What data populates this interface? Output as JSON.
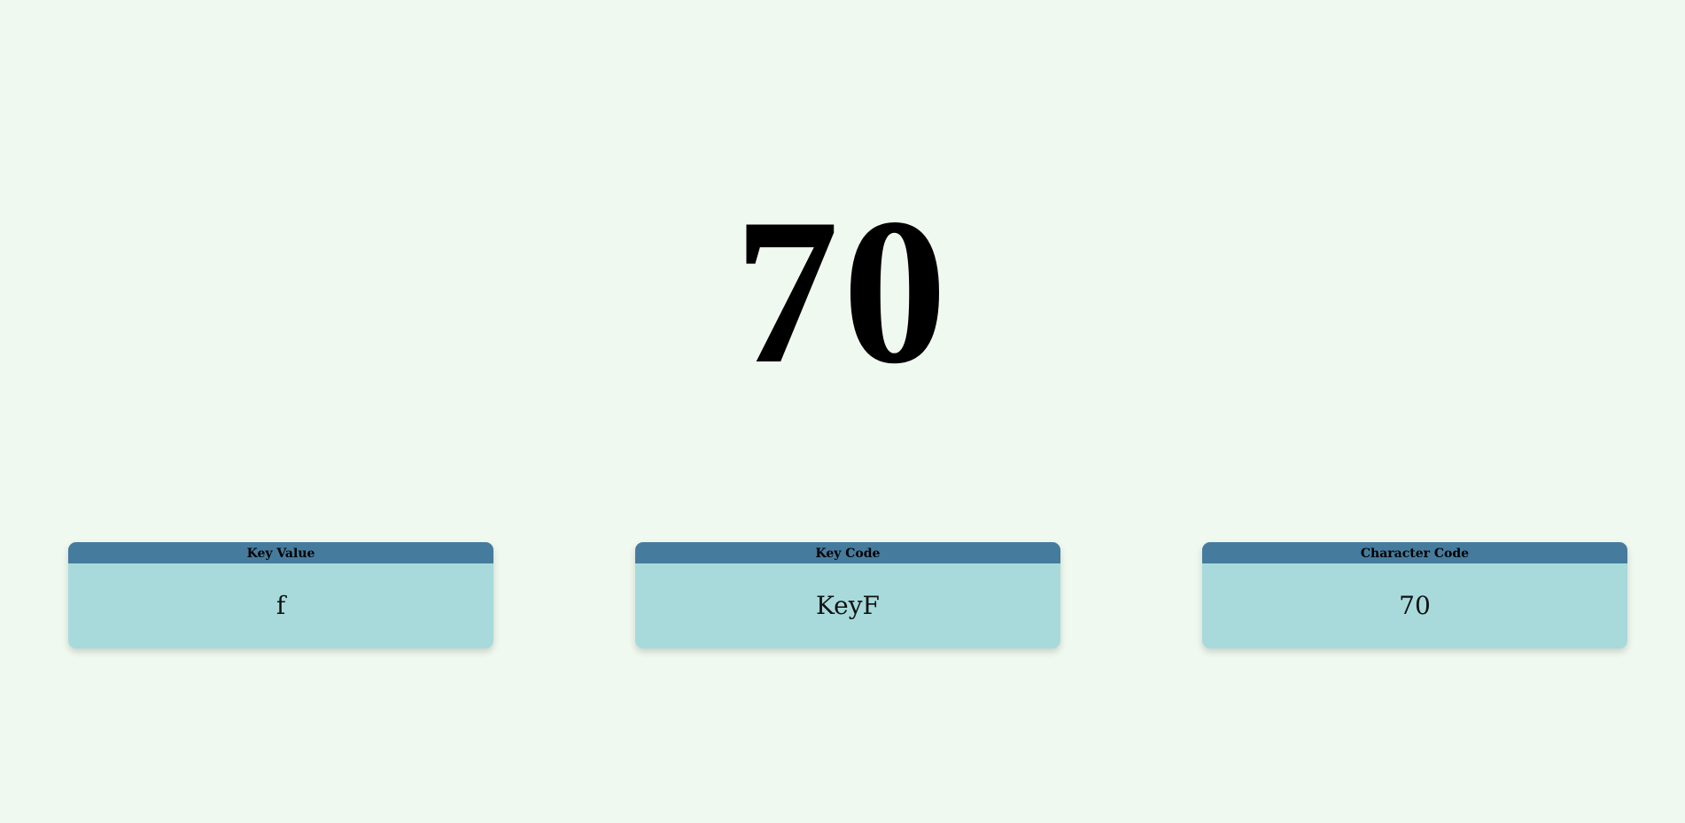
{
  "main": {
    "big_value": "70"
  },
  "cards": [
    {
      "label": "Key Value",
      "value": "f"
    },
    {
      "label": "Key Code",
      "value": "KeyF"
    },
    {
      "label": "Character Code",
      "value": "70"
    }
  ],
  "colors": {
    "background": "#f0f9ef",
    "card_header": "#457b9d",
    "card_body": "#a8dadc"
  }
}
